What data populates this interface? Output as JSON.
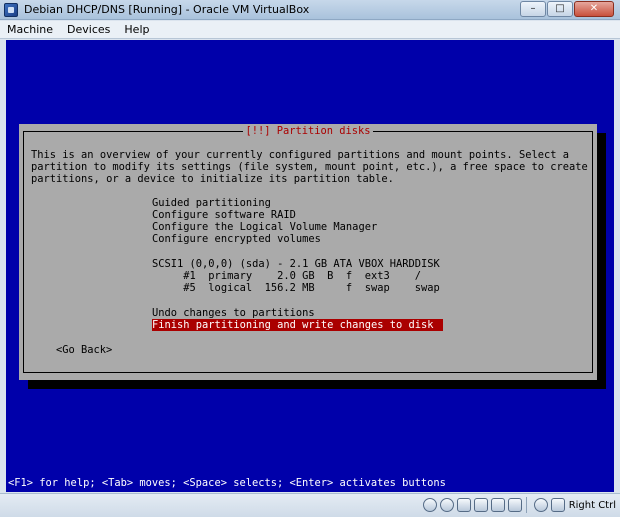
{
  "window": {
    "title": "Debian DHCP/DNS [Running] - Oracle VM VirtualBox",
    "minimize": "–",
    "maximize": "□",
    "close": "✕"
  },
  "menu": [
    "Machine",
    "Devices",
    "Help"
  ],
  "dialog": {
    "title": "[!!] Partition disks",
    "description": [
      "This is an overview of your currently configured partitions and mount points. Select a",
      "partition to modify its settings (file system, mount point, etc.), a free space to create",
      "partitions, or a device to initialize its partition table."
    ],
    "options": [
      "Guided partitioning",
      "Configure software RAID",
      "Configure the Logical Volume Manager",
      "Configure encrypted volumes"
    ],
    "disk": "SCSI1 (0,0,0) (sda) - 2.1 GB ATA VBOX HARDDISK",
    "partitions": [
      "     #1  primary    2.0 GB  B  f  ext3    /",
      "     #5  logical  156.2 MB     f  swap    swap"
    ],
    "undo": "Undo changes to partitions",
    "finish": "Finish partitioning and write changes to disk",
    "go_back": "<Go Back>"
  },
  "status_line": "<F1> for help; <Tab> moves; <Space> selects; <Enter> activates buttons",
  "statusbar": {
    "host_key": "Right Ctrl"
  },
  "colors": {
    "screen_bg": "#0000aa",
    "dialog_bg": "#aaaaaa",
    "title_red": "#aa0000",
    "highlight": "#aa0000"
  }
}
